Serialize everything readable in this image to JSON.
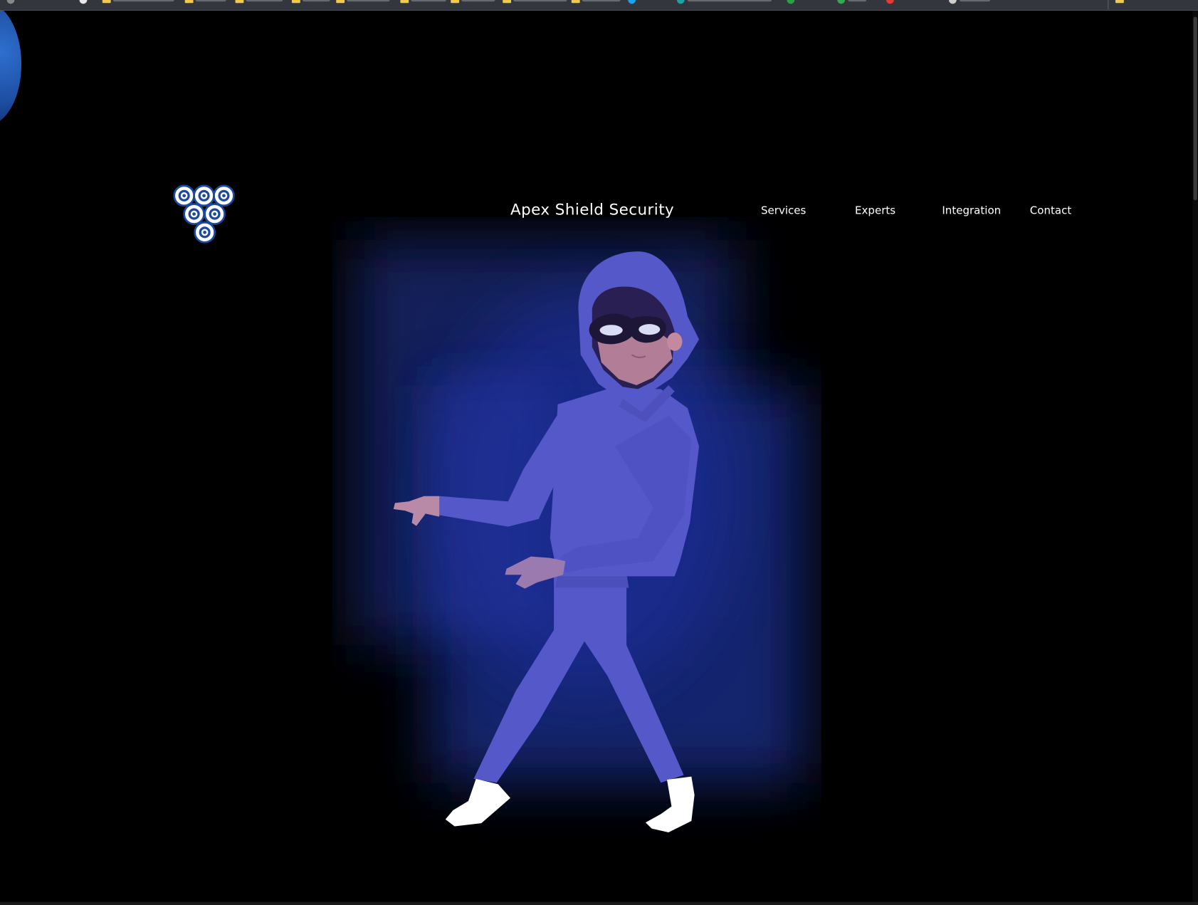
{
  "site": {
    "title": "Apex Shield Security"
  },
  "nav": {
    "items": [
      {
        "label": "Services"
      },
      {
        "label": "Experts"
      },
      {
        "label": "Integration"
      },
      {
        "label": "Contact"
      }
    ]
  },
  "logo": {
    "icon": "shield-cluster-icon"
  },
  "hero": {
    "image": "hooded-intruder-illustration"
  },
  "colors": {
    "background": "#000000",
    "accent_blue": "#5458c9",
    "glow": "#1a2a8a",
    "logo_blue": "#1d4a9c",
    "text": "#ffffff"
  }
}
